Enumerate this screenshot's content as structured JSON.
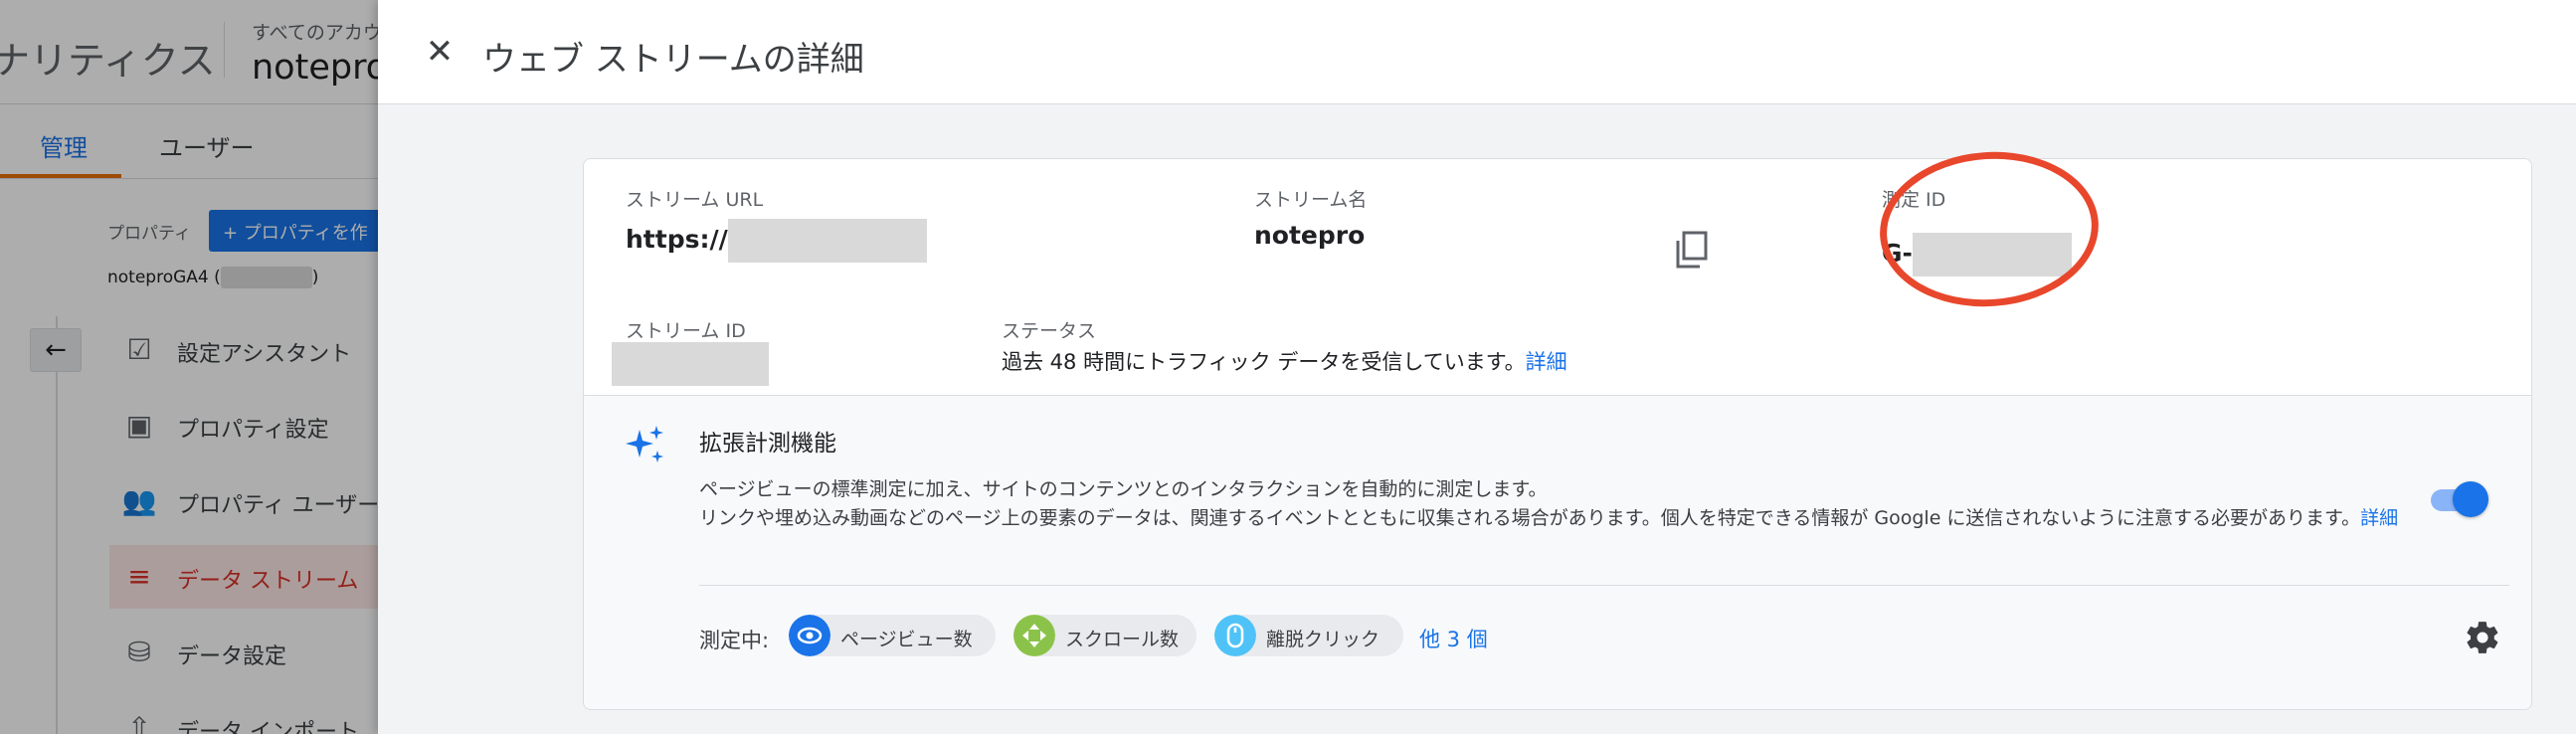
{
  "background": {
    "app_title": "ナリティクス",
    "account_label": "すべてのアカウ",
    "account_name": "notepro",
    "tabs": [
      {
        "label": "管理"
      },
      {
        "label": "ユーザー"
      }
    ],
    "property_label": "プロパティ",
    "create_property_button": "+ プロパティを作",
    "property_name": "noteproGA4 (",
    "property_name_close": ")",
    "back_icon": "←",
    "nav_items": [
      {
        "label": "設定アシスタント",
        "icon": "☑"
      },
      {
        "label": "プロパティ設定",
        "icon": "▣"
      },
      {
        "label": "プロパティ ユーザーの",
        "icon": "👥"
      },
      {
        "label": "データ ストリーム",
        "icon": "≡"
      },
      {
        "label": "データ設定",
        "icon": "⛁"
      },
      {
        "label": "データ インポート",
        "icon": "⇧"
      }
    ]
  },
  "panel": {
    "close_icon": "✕",
    "title": "ウェブ ストリームの詳細",
    "stream_url_label": "ストリーム URL",
    "stream_url_value": "https://",
    "stream_name_label": "ストリーム名",
    "stream_name_value": "notepro",
    "measurement_id_label": "測定 ID",
    "measurement_id_value": "G-",
    "stream_id_label": "ストリーム ID",
    "status_label": "ステータス",
    "status_text": "過去 48 時間にトラフィック データを受信しています。",
    "status_link": "詳細"
  },
  "enhanced": {
    "title": "拡張計測機能",
    "desc_line1": "ページビューの標準測定に加え、サイトのコンテンツとのインタラクションを自動的に測定します。",
    "desc_line2": "リンクや埋め込み動画などのページ上の要素のデータは、関連するイベントとともに収集される場合があります。個人を特定できる情報が Google に送信されないように注意する必要があります。",
    "desc_link": "詳細",
    "toggle_on": true,
    "measuring_label": "測定中:",
    "chips": [
      {
        "label": "ページビュー数",
        "icon": "eye-icon",
        "color": "#1a73e8"
      },
      {
        "label": "スクロール数",
        "icon": "scroll-icon",
        "color": "#8bc34a"
      },
      {
        "label": "離脱クリック",
        "icon": "mouse-icon",
        "color": "#4fc3f7"
      }
    ],
    "more_link": "他 3 個"
  },
  "colors": {
    "accent": "#1a73e8",
    "annotation": "#e8472c",
    "active_nav": "#d93025"
  }
}
